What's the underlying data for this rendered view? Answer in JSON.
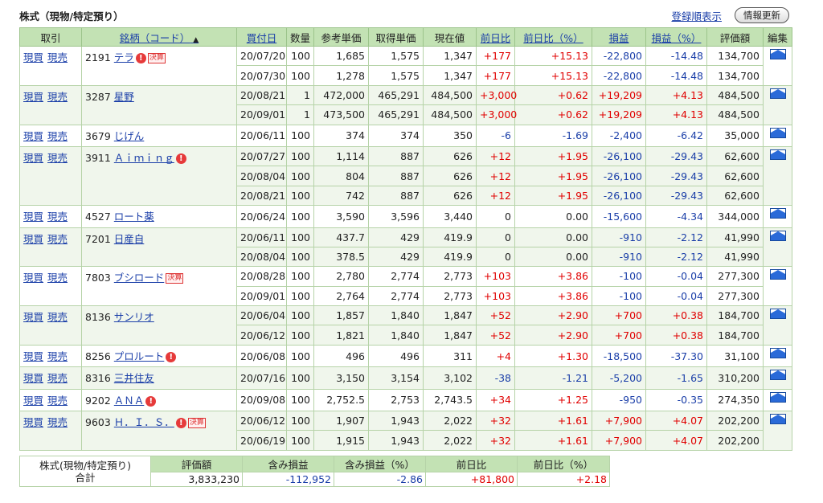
{
  "header": {
    "title": "株式（現物/特定預り）",
    "sort_link": "登録順表示",
    "refresh_button": "情報更新"
  },
  "columns": {
    "trade": "取引",
    "name": "銘柄（コード）",
    "date": "買付日",
    "qty": "数量",
    "ref_price": "参考単価",
    "cost_price": "取得単価",
    "current": "現在値",
    "day_change": "前日比",
    "day_change_pct": "前日比（%）",
    "pl": "損益",
    "pl_pct": "損益（%）",
    "value": "評価額",
    "edit": "編集"
  },
  "action_labels": {
    "buy": "現買",
    "sell": "現売"
  },
  "stocks": [
    {
      "code": "2191",
      "name": "テラ",
      "alert": true,
      "kessan": "決算",
      "rows": [
        {
          "date": "20/07/20",
          "qty": "100",
          "ref": "1,685",
          "cost": "1,575",
          "cur": "1,347",
          "chg": "+177",
          "chgp": "+15.13",
          "pl": "-22,800",
          "plp": "-14.48",
          "val": "134,700"
        },
        {
          "date": "20/07/30",
          "qty": "100",
          "ref": "1,278",
          "cost": "1,575",
          "cur": "1,347",
          "chg": "+177",
          "chgp": "+15.13",
          "pl": "-22,800",
          "plp": "-14.48",
          "val": "134,700"
        }
      ]
    },
    {
      "code": "3287",
      "name": "星野",
      "alert": false,
      "kessan": "",
      "rows": [
        {
          "date": "20/08/21",
          "qty": "1",
          "ref": "472,000",
          "cost": "465,291",
          "cur": "484,500",
          "chg": "+3,000",
          "chgp": "+0.62",
          "pl": "+19,209",
          "plp": "+4.13",
          "val": "484,500"
        },
        {
          "date": "20/09/01",
          "qty": "1",
          "ref": "473,500",
          "cost": "465,291",
          "cur": "484,500",
          "chg": "+3,000",
          "chgp": "+0.62",
          "pl": "+19,209",
          "plp": "+4.13",
          "val": "484,500"
        }
      ]
    },
    {
      "code": "3679",
      "name": "じげん",
      "alert": false,
      "kessan": "",
      "rows": [
        {
          "date": "20/06/11",
          "qty": "100",
          "ref": "374",
          "cost": "374",
          "cur": "350",
          "chg": "-6",
          "chgp": "-1.69",
          "pl": "-2,400",
          "plp": "-6.42",
          "val": "35,000"
        }
      ]
    },
    {
      "code": "3911",
      "name": "Ａｉｍｉｎｇ",
      "alert": true,
      "kessan": "",
      "rows": [
        {
          "date": "20/07/27",
          "qty": "100",
          "ref": "1,114",
          "cost": "887",
          "cur": "626",
          "chg": "+12",
          "chgp": "+1.95",
          "pl": "-26,100",
          "plp": "-29.43",
          "val": "62,600"
        },
        {
          "date": "20/08/04",
          "qty": "100",
          "ref": "804",
          "cost": "887",
          "cur": "626",
          "chg": "+12",
          "chgp": "+1.95",
          "pl": "-26,100",
          "plp": "-29.43",
          "val": "62,600"
        },
        {
          "date": "20/08/21",
          "qty": "100",
          "ref": "742",
          "cost": "887",
          "cur": "626",
          "chg": "+12",
          "chgp": "+1.95",
          "pl": "-26,100",
          "plp": "-29.43",
          "val": "62,600"
        }
      ]
    },
    {
      "code": "4527",
      "name": "ロート薬",
      "alert": false,
      "kessan": "",
      "rows": [
        {
          "date": "20/06/24",
          "qty": "100",
          "ref": "3,590",
          "cost": "3,596",
          "cur": "3,440",
          "chg": "0",
          "chgp": "0.00",
          "pl": "-15,600",
          "plp": "-4.34",
          "val": "344,000"
        }
      ]
    },
    {
      "code": "7201",
      "name": "日産自",
      "alert": false,
      "kessan": "",
      "rows": [
        {
          "date": "20/06/11",
          "qty": "100",
          "ref": "437.7",
          "cost": "429",
          "cur": "419.9",
          "chg": "0",
          "chgp": "0.00",
          "pl": "-910",
          "plp": "-2.12",
          "val": "41,990"
        },
        {
          "date": "20/08/04",
          "qty": "100",
          "ref": "378.5",
          "cost": "429",
          "cur": "419.9",
          "chg": "0",
          "chgp": "0.00",
          "pl": "-910",
          "plp": "-2.12",
          "val": "41,990"
        }
      ]
    },
    {
      "code": "7803",
      "name": "ブシロード",
      "alert": false,
      "kessan": "決算",
      "rows": [
        {
          "date": "20/08/28",
          "qty": "100",
          "ref": "2,780",
          "cost": "2,774",
          "cur": "2,773",
          "chg": "+103",
          "chgp": "+3.86",
          "pl": "-100",
          "plp": "-0.04",
          "val": "277,300"
        },
        {
          "date": "20/09/01",
          "qty": "100",
          "ref": "2,764",
          "cost": "2,774",
          "cur": "2,773",
          "chg": "+103",
          "chgp": "+3.86",
          "pl": "-100",
          "plp": "-0.04",
          "val": "277,300"
        }
      ]
    },
    {
      "code": "8136",
      "name": "サンリオ",
      "alert": false,
      "kessan": "",
      "rows": [
        {
          "date": "20/06/04",
          "qty": "100",
          "ref": "1,857",
          "cost": "1,840",
          "cur": "1,847",
          "chg": "+52",
          "chgp": "+2.90",
          "pl": "+700",
          "plp": "+0.38",
          "val": "184,700"
        },
        {
          "date": "20/06/12",
          "qty": "100",
          "ref": "1,821",
          "cost": "1,840",
          "cur": "1,847",
          "chg": "+52",
          "chgp": "+2.90",
          "pl": "+700",
          "plp": "+0.38",
          "val": "184,700"
        }
      ]
    },
    {
      "code": "8256",
      "name": "プロルート",
      "alert": true,
      "kessan": "",
      "rows": [
        {
          "date": "20/06/08",
          "qty": "100",
          "ref": "496",
          "cost": "496",
          "cur": "311",
          "chg": "+4",
          "chgp": "+1.30",
          "pl": "-18,500",
          "plp": "-37.30",
          "val": "31,100"
        }
      ]
    },
    {
      "code": "8316",
      "name": "三井住友",
      "alert": false,
      "kessan": "",
      "rows": [
        {
          "date": "20/07/16",
          "qty": "100",
          "ref": "3,150",
          "cost": "3,154",
          "cur": "3,102",
          "chg": "-38",
          "chgp": "-1.21",
          "pl": "-5,200",
          "plp": "-1.65",
          "val": "310,200"
        }
      ]
    },
    {
      "code": "9202",
      "name": "ＡＮＡ",
      "alert": true,
      "kessan": "",
      "rows": [
        {
          "date": "20/09/08",
          "qty": "100",
          "ref": "2,752.5",
          "cost": "2,753",
          "cur": "2,743.5",
          "chg": "+34",
          "chgp": "+1.25",
          "pl": "-950",
          "plp": "-0.35",
          "val": "274,350"
        }
      ]
    },
    {
      "code": "9603",
      "name": "Ｈ．Ｉ．Ｓ．",
      "alert": true,
      "kessan": "決算",
      "rows": [
        {
          "date": "20/06/12",
          "qty": "100",
          "ref": "1,907",
          "cost": "1,943",
          "cur": "2,022",
          "chg": "+32",
          "chgp": "+1.61",
          "pl": "+7,900",
          "plp": "+4.07",
          "val": "202,200"
        },
        {
          "date": "20/06/19",
          "qty": "100",
          "ref": "1,915",
          "cost": "1,943",
          "cur": "2,022",
          "chg": "+32",
          "chgp": "+1.61",
          "pl": "+7,900",
          "plp": "+4.07",
          "val": "202,200"
        }
      ]
    }
  ],
  "summary": {
    "label_line1": "株式(現物/特定預り)",
    "label_line2": "合計",
    "headers": [
      "評価額",
      "含み損益",
      "含み損益（%）",
      "前日比",
      "前日比（%）"
    ],
    "values": [
      "3,833,230",
      "-112,952",
      "-2.86",
      "+81,800",
      "+2.18"
    ]
  },
  "colors": {
    "header_green": "#c3e2b4",
    "row_tint": "#f0f6ec",
    "positive": "#e00000",
    "negative": "#1a3ea8"
  }
}
